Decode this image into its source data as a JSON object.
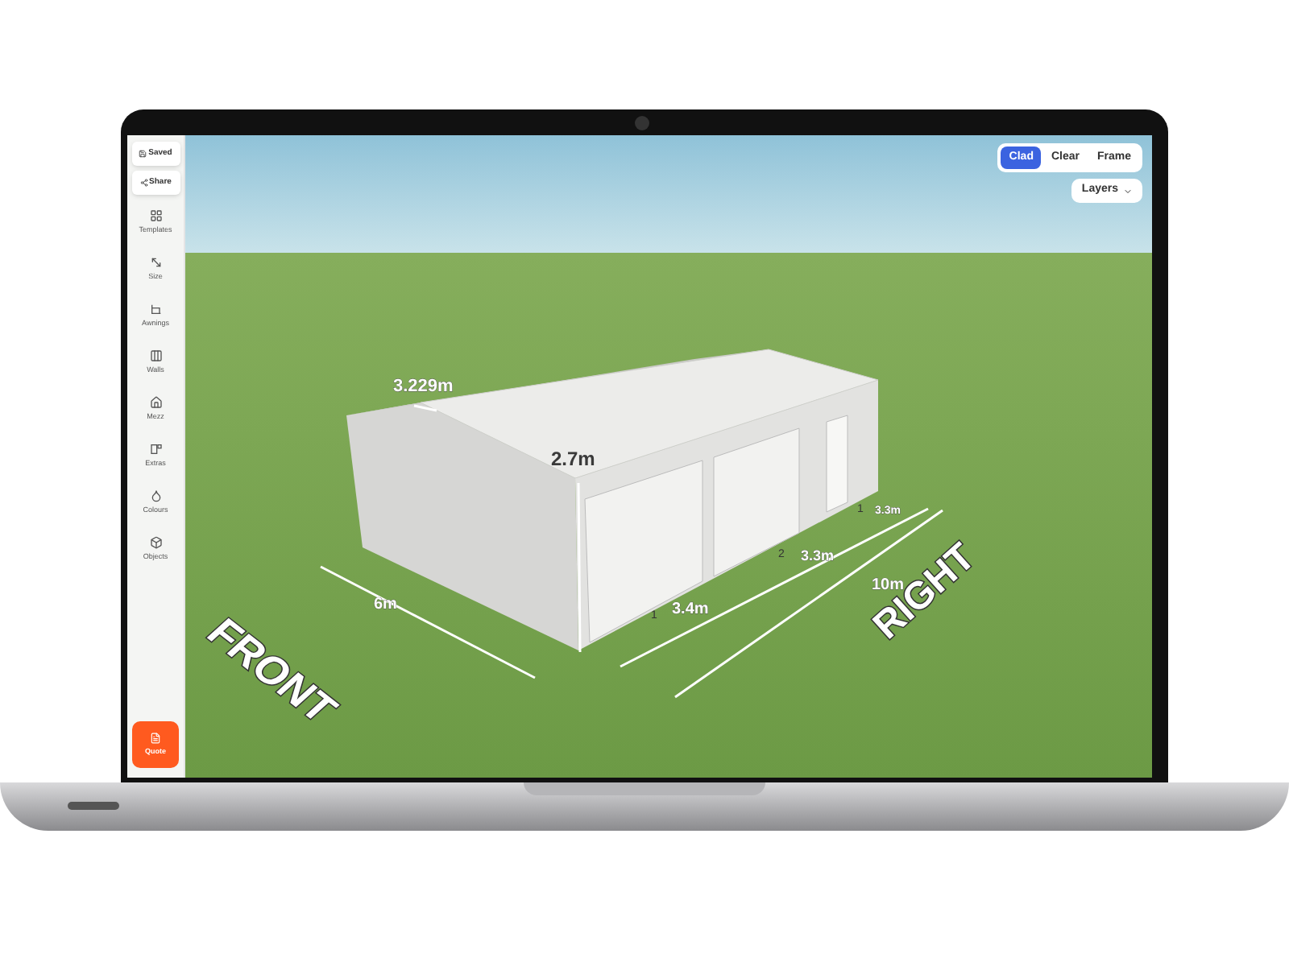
{
  "sidebar": {
    "actions": [
      {
        "label": "Saved",
        "kind": "saved"
      },
      {
        "label": "Share",
        "kind": "share"
      }
    ],
    "items": [
      {
        "label": "Templates",
        "kind": "templates"
      },
      {
        "label": "Size",
        "kind": "size"
      },
      {
        "label": "Awnings",
        "kind": "awnings"
      },
      {
        "label": "Walls",
        "kind": "walls"
      },
      {
        "label": "Mezz",
        "kind": "mezz"
      },
      {
        "label": "Extras",
        "kind": "extras"
      },
      {
        "label": "Colours",
        "kind": "colours"
      },
      {
        "label": "Objects",
        "kind": "objects"
      }
    ],
    "quote_button": {
      "label": "Quote"
    }
  },
  "view_modes": [
    {
      "label": "Clad",
      "selected": true
    },
    {
      "label": "Clear",
      "selected": false
    },
    {
      "label": "Frame",
      "selected": false
    }
  ],
  "layers_dropdown": {
    "label": "Layers"
  },
  "scene": {
    "ridge_label": "3.229m",
    "height_label": "2.7m",
    "width_label": "6m",
    "door_width_label": "3.4m",
    "bay_labels": [
      "3.3m",
      "3.3m"
    ],
    "length_label": "10m",
    "front_label": "FRONT",
    "right_label": "RIGHT",
    "door_numbers": [
      "1",
      "2",
      "1"
    ]
  }
}
